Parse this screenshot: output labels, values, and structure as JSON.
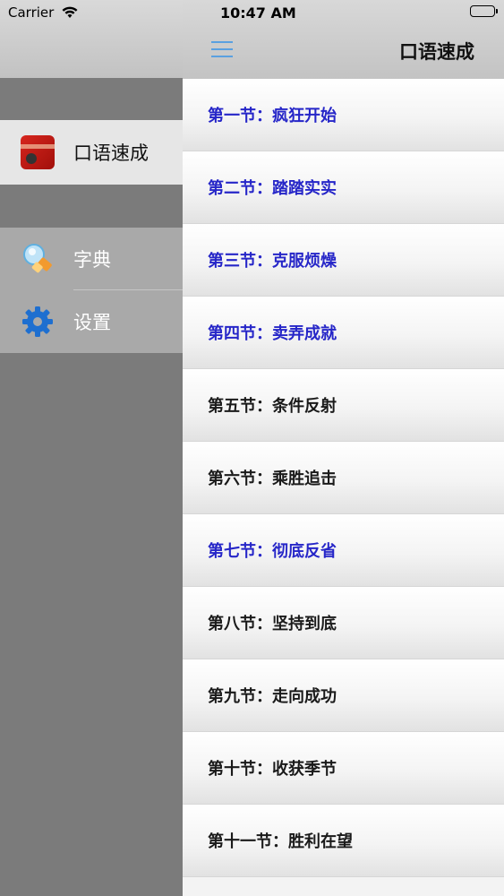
{
  "status_bar": {
    "carrier": "Carrier",
    "time": "10:47 AM",
    "battery_level": 1.0
  },
  "drawer": {
    "items": [
      {
        "label": "口语速成",
        "icon": "app-logo-icon",
        "active": true
      },
      {
        "label": "字典",
        "icon": "dictionary-icon",
        "active": false
      },
      {
        "label": "设置",
        "icon": "gear-icon",
        "active": false
      }
    ]
  },
  "navbar": {
    "title": "口语速成",
    "menu_icon": "hamburger-menu-icon",
    "accent_color": "#5aa0e0"
  },
  "lessons": [
    {
      "label": "第一节：疯狂开始",
      "color": "#2626c8"
    },
    {
      "label": "第二节：踏踏实实",
      "color": "#2626c8"
    },
    {
      "label": "第三节：克服烦燥",
      "color": "#2626c8"
    },
    {
      "label": "第四节：卖弄成就",
      "color": "#2626c8"
    },
    {
      "label": "第五节：条件反射",
      "color": "#1a1a1a"
    },
    {
      "label": "第六节：乘胜追击",
      "color": "#1a1a1a"
    },
    {
      "label": "第七节：彻底反省",
      "color": "#2626c8"
    },
    {
      "label": "第八节：坚持到底",
      "color": "#1a1a1a"
    },
    {
      "label": "第九节：走向成功",
      "color": "#1a1a1a"
    },
    {
      "label": "第十节：收获季节",
      "color": "#1a1a1a"
    },
    {
      "label": "第十一节：胜利在望",
      "color": "#1a1a1a"
    }
  ]
}
